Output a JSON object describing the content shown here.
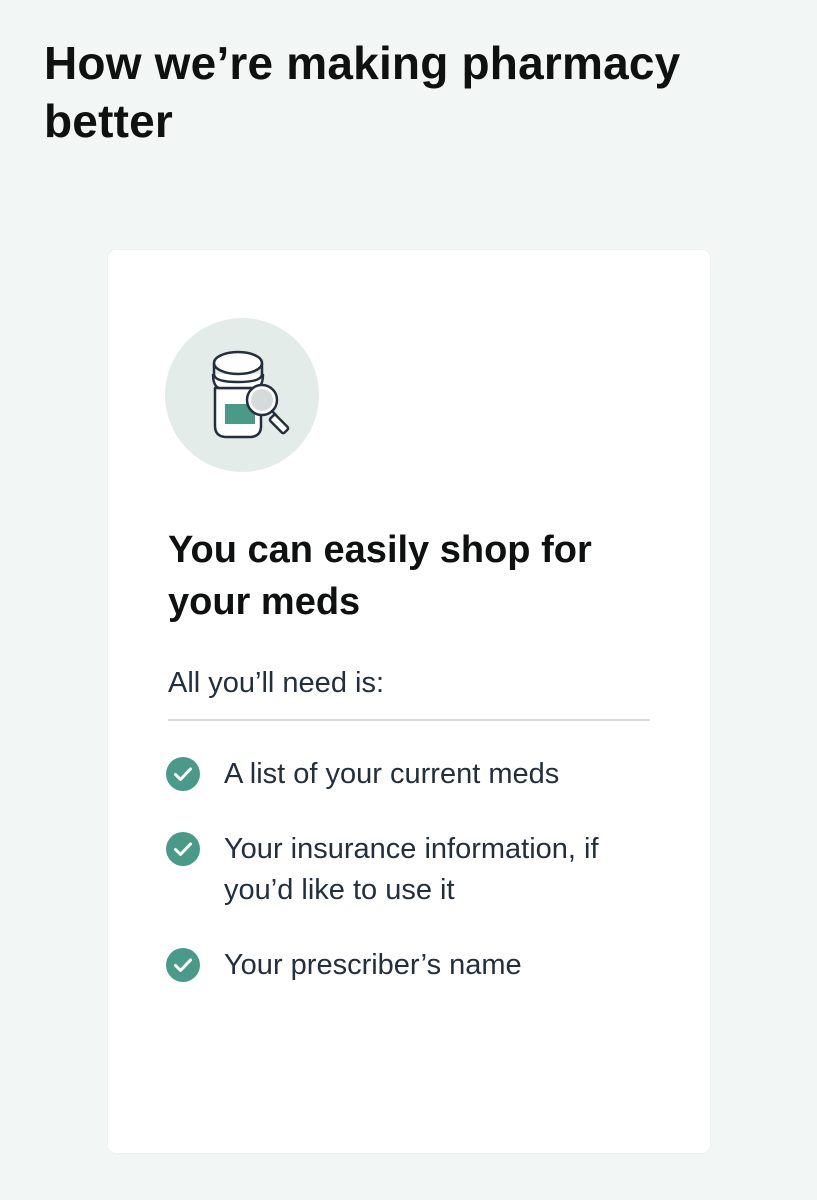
{
  "header": {
    "title": "How we’re making pharmacy better"
  },
  "card": {
    "illustration": "pill-bottle-magnifier-icon",
    "title": "You can easily shop for your meds",
    "subtitle": "All you’ll need is:",
    "checklist": [
      {
        "icon": "check-circle-icon",
        "label": "A list of your current meds"
      },
      {
        "icon": "check-circle-icon",
        "label": "Your insurance information, if you’d like to use it"
      },
      {
        "icon": "check-circle-icon",
        "label": "Your prescriber’s name"
      }
    ]
  },
  "colors": {
    "page_background": "#f2f6f5",
    "card_background": "#ffffff",
    "accent_teal": "#4a9a8a",
    "icon_circle": "#e4ece9",
    "text_dark": "#0f1111",
    "text_body": "#232f3e"
  }
}
